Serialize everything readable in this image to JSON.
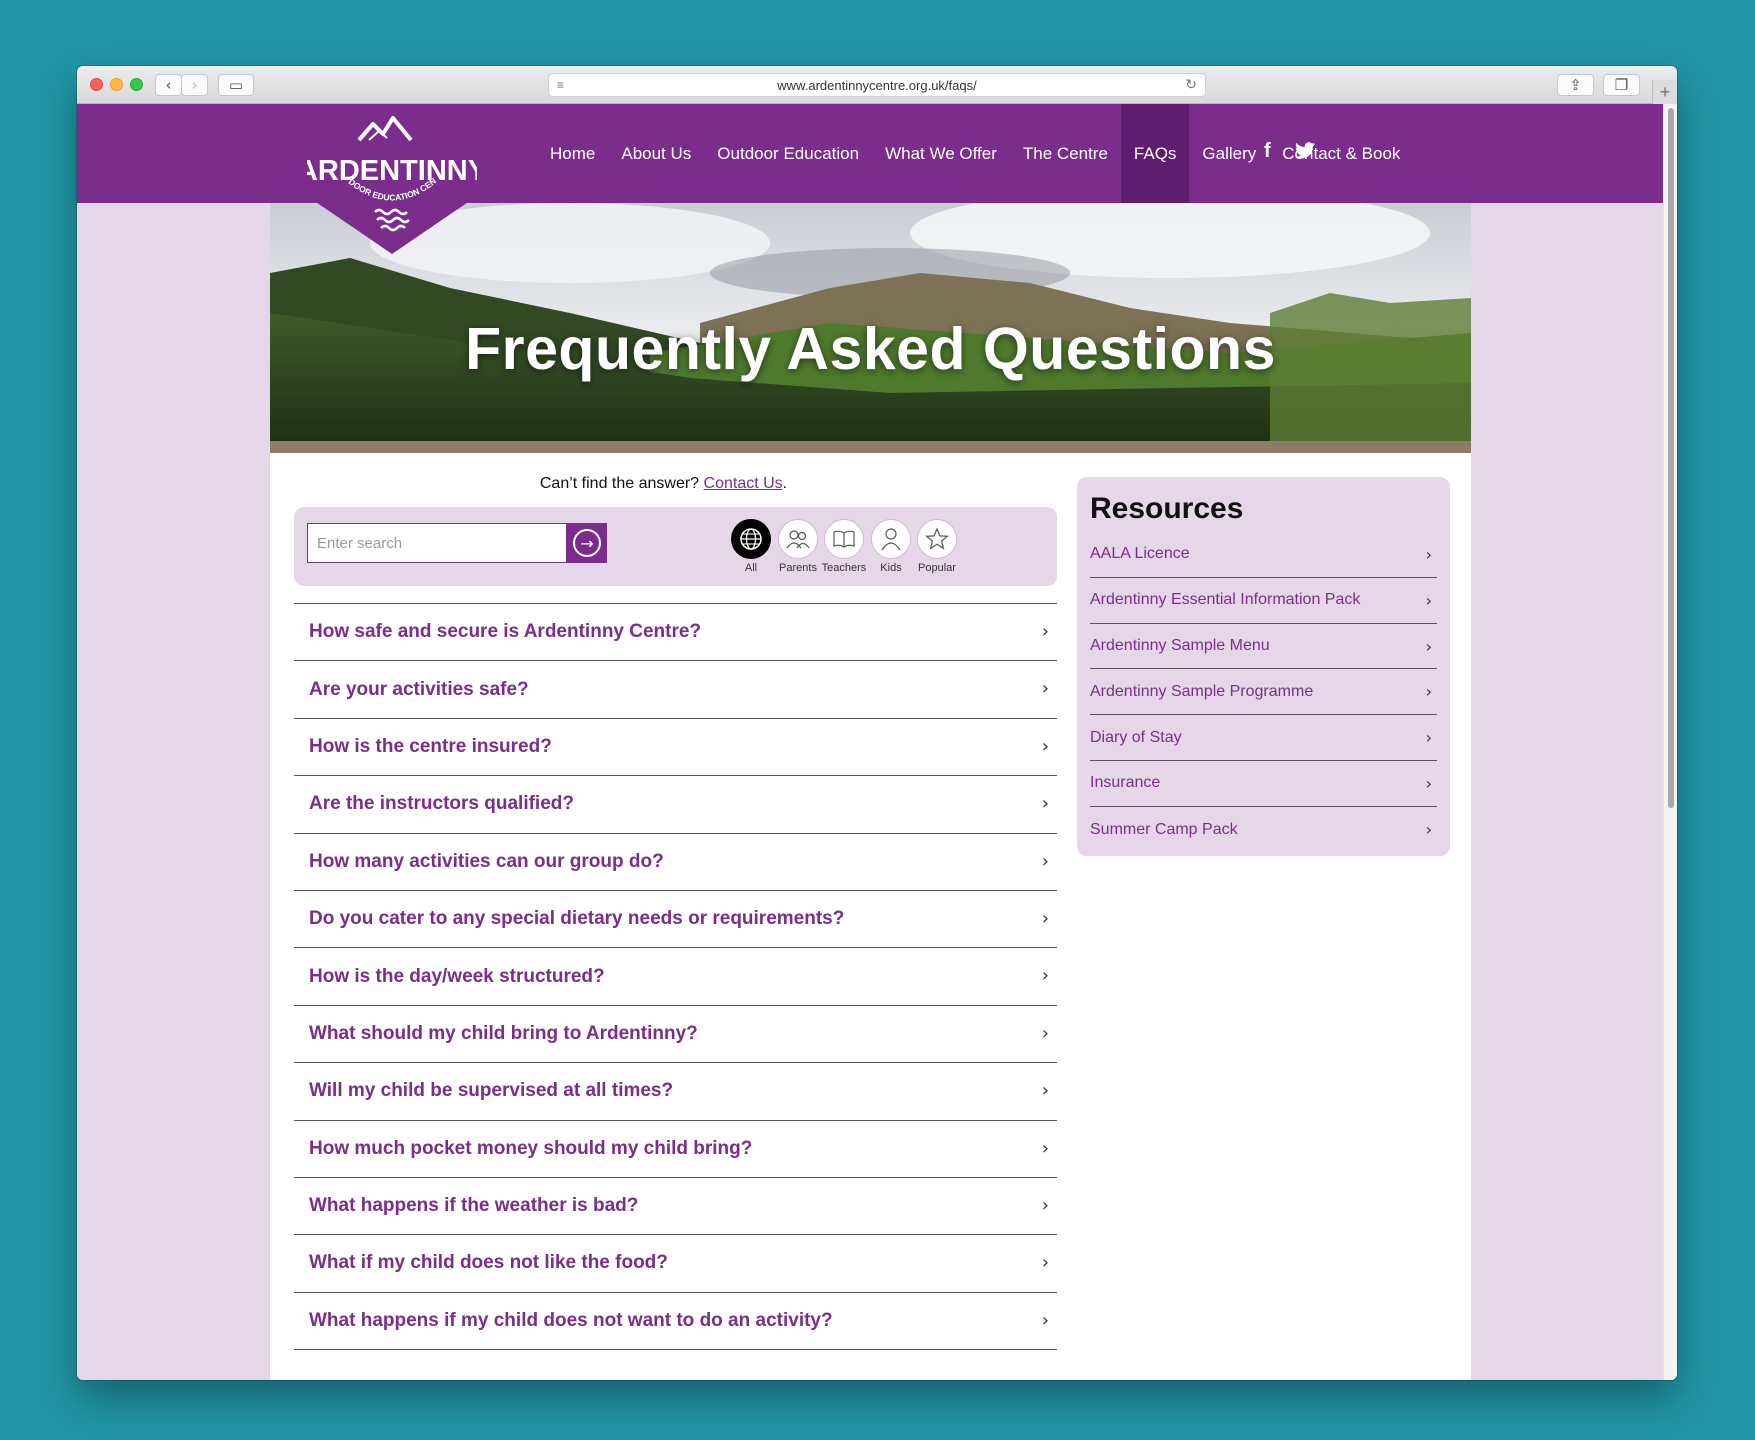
{
  "browser": {
    "url": "www.ardentinnycentre.org.uk/faqs/",
    "back_glyph": "‹",
    "forward_glyph": "›",
    "sidebar_glyph": "▭",
    "share_glyph": "⇪",
    "tabs_glyph": "❐",
    "reader_glyph": "≡",
    "reload_glyph": "↻",
    "new_tab_glyph": "+"
  },
  "brand": {
    "name": "ARDENTINNY",
    "tagline": "OUTDOOR EDUCATION CENTRE",
    "color": "#7b2d8b",
    "dark": "#5e1e6d",
    "light": "#e6d7e8"
  },
  "nav": {
    "items": [
      "Home",
      "About Us",
      "Outdoor Education",
      "What We Offer",
      "The Centre",
      "FAQs",
      "Gallery",
      "Contact & Book"
    ],
    "active": "FAQs",
    "facebook": "f",
    "twitter": "🐦"
  },
  "hero": {
    "title": "Frequently Asked Questions"
  },
  "helper": {
    "text": "Can’t find the answer? ",
    "link": "Contact Us",
    "suffix": "."
  },
  "search": {
    "placeholder": "Enter search",
    "go_glyph": "→"
  },
  "filters": [
    {
      "label": "All",
      "icon": "globe-icon",
      "selected": true
    },
    {
      "label": "Parents",
      "icon": "parents-icon",
      "selected": false
    },
    {
      "label": "Teachers",
      "icon": "book-icon",
      "selected": false
    },
    {
      "label": "Kids",
      "icon": "kid-icon",
      "selected": false
    },
    {
      "label": "Popular",
      "icon": "star-icon",
      "selected": false
    }
  ],
  "faqs": [
    "How safe and secure is Ardentinny Centre?",
    "Are your activities safe?",
    "How is the centre insured?",
    "Are the instructors qualified?",
    "How many activities can our group do?",
    "Do you cater to any special dietary needs or requirements?",
    "How is the day/week structured?",
    "What should my child bring to Ardentinny?",
    "Will my child be supervised at all times?",
    "How much pocket money should my child bring?",
    "What happens if the weather is bad?",
    "What if my child does not like the food?",
    "What happens if my child does not want to do an activity?"
  ],
  "resources": {
    "title": "Resources",
    "items": [
      "AALA Licence",
      "Ardentinny Essential Information Pack",
      "Ardentinny Sample Menu",
      "Ardentinny Sample Programme",
      "Diary of Stay",
      "Insurance",
      "Summer Camp Pack"
    ]
  },
  "chevron": "›"
}
